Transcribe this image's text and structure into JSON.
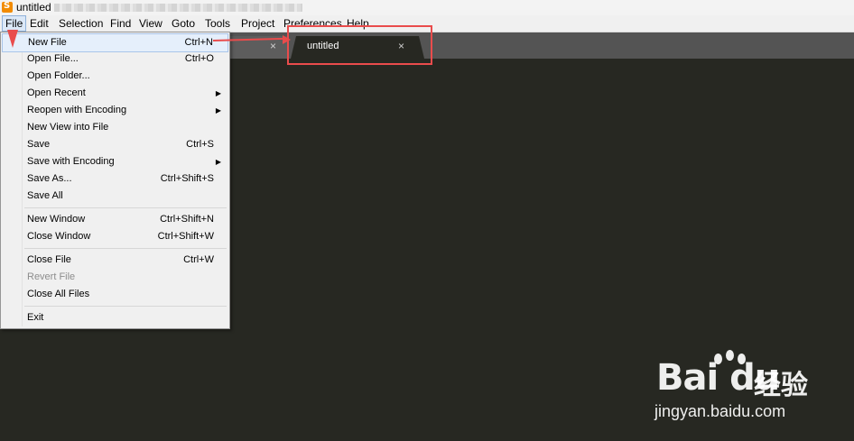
{
  "window": {
    "title": "untitled"
  },
  "menubar": [
    "File",
    "Edit",
    "Selection",
    "Find",
    "View",
    "Goto",
    "Tools",
    "Project",
    "Preferences",
    "Help"
  ],
  "tabs": [
    {
      "label": "",
      "close": "×"
    },
    {
      "label": "untitled",
      "close": "×"
    }
  ],
  "file_menu": {
    "items": [
      {
        "label": "New File",
        "shortcut": "Ctrl+N"
      },
      {
        "label": "Open File...",
        "shortcut": "Ctrl+O"
      },
      {
        "label": "Open Folder...",
        "shortcut": ""
      },
      {
        "label": "Open Recent",
        "shortcut": ""
      },
      {
        "label": "Reopen with Encoding",
        "shortcut": ""
      },
      {
        "label": "New View into File",
        "shortcut": ""
      },
      {
        "label": "Save",
        "shortcut": "Ctrl+S"
      },
      {
        "label": "Save with Encoding",
        "shortcut": ""
      },
      {
        "label": "Save As...",
        "shortcut": "Ctrl+Shift+S"
      },
      {
        "label": "Save All",
        "shortcut": ""
      },
      {
        "label": "New Window",
        "shortcut": "Ctrl+Shift+N"
      },
      {
        "label": "Close Window",
        "shortcut": "Ctrl+Shift+W"
      },
      {
        "label": "Close File",
        "shortcut": "Ctrl+W"
      },
      {
        "label": "Revert File",
        "shortcut": ""
      },
      {
        "label": "Close All Files",
        "shortcut": ""
      },
      {
        "label": "Exit",
        "shortcut": ""
      }
    ]
  },
  "watermark": {
    "logo": "Bai du",
    "cn": "经验",
    "url": "jingyan.baidu.com"
  },
  "colors": {
    "accent": "#e94c4c",
    "editor_bg": "#272822",
    "menu_bg": "#f0f0f0"
  },
  "icons": {
    "app": "sublime-text-icon",
    "submenu": "triangle-right-icon"
  }
}
